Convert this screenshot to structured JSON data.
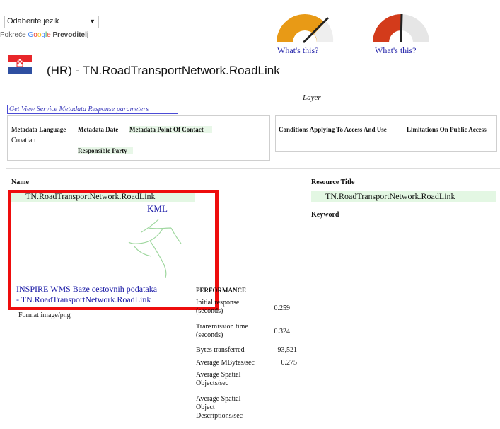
{
  "translate": {
    "select_value": "Odaberite jezik",
    "powered_prefix": "Pokreće",
    "google": [
      "G",
      "o",
      "o",
      "g",
      "l",
      "e"
    ],
    "translator": "Prevoditelj"
  },
  "gauges": [
    {
      "name": "availability",
      "link": "What's this?",
      "color": "#e89a16",
      "needle": "high"
    },
    {
      "name": "performance",
      "link": "What's this?",
      "color": "#d33b1b",
      "needle": "mid"
    }
  ],
  "header": {
    "title": "(HR) - TN.RoadTransportNetwork.RoadLink",
    "flag_colors": [
      "#e8262a",
      "#ffffff",
      "#2e4fa1"
    ]
  },
  "layer_label": "Layer",
  "get_view_button": "Get View Service Metadata Response parameters",
  "metadata_panel": {
    "language_label": "Metadata Language",
    "language_value": "Croatian",
    "date_label": "Metadata Date",
    "contact_label": "Metadata Point Of Contact",
    "responsible_label": "Responsible Party"
  },
  "conditions_panel": {
    "conditions_label": "Conditions Applying To Access And Use",
    "limitations_label": "Limitations On Public Access"
  },
  "layer": {
    "name_label": "Name",
    "name_value": "TN.RoadTransportNetwork.RoadLink",
    "kml_link": "KML",
    "wms_title_line1": "INSPIRE WMS Baze cestovnih podataka",
    "wms_title_line2": "- TN.RoadTransportNetwork.RoadLink",
    "format_label": "Format image/png",
    "resource_title_label": "Resource Title",
    "resource_title_value": "TN.RoadTransportNetwork.RoadLink",
    "keyword_label": "Keyword"
  },
  "performance": {
    "heading": "PERFORMANCE",
    "rows": [
      {
        "label": "Initial response (seconds)",
        "value": "0.259"
      },
      {
        "label": "Transmission time (seconds)",
        "value": "0.324"
      },
      {
        "label": "Bytes transferred",
        "value": "93,521"
      },
      {
        "label": "Average MBytes/sec",
        "value": "0.275"
      },
      {
        "label": "Average Spatial Objects/sec",
        "value": ""
      },
      {
        "label": "Average Spatial Object Descriptions/sec",
        "value": ""
      }
    ]
  }
}
